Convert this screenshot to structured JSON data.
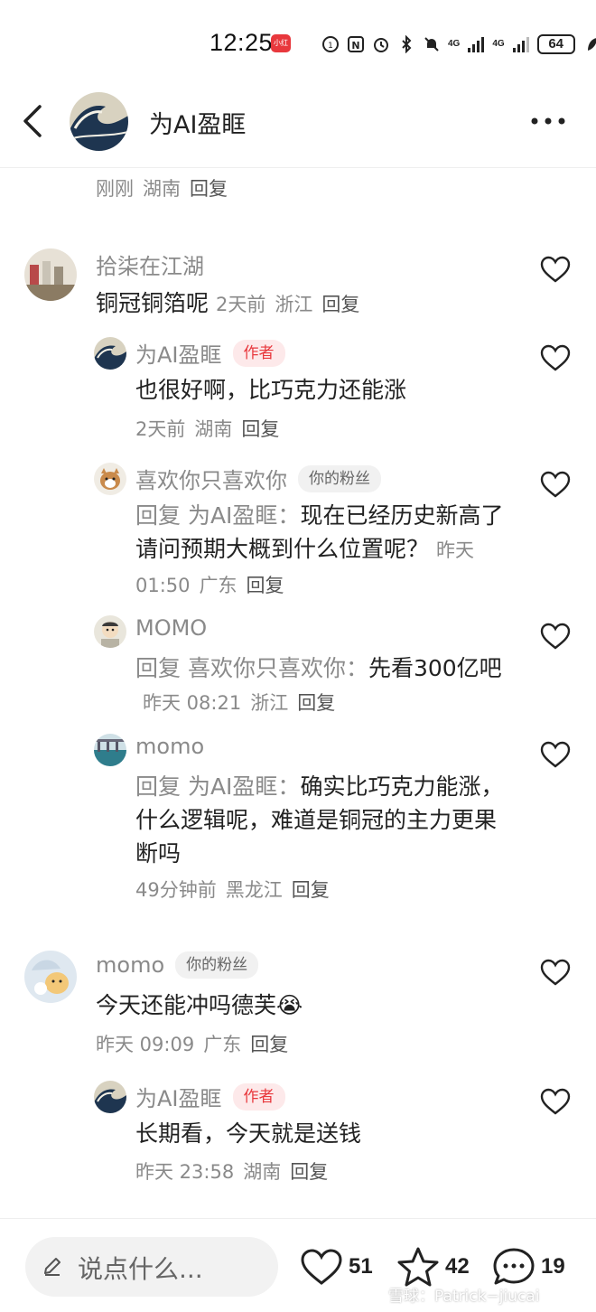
{
  "status_bar": {
    "time": "12:25",
    "badge": "小红书",
    "network_1": "4G",
    "network_2": "4G",
    "battery": "64"
  },
  "header": {
    "title": "为AI盈眶"
  },
  "top_meta": {
    "time": "刚刚",
    "location": "湖南",
    "reply": "回复"
  },
  "comments": [
    {
      "author": "拾柒在江湖",
      "text": "铜冠铜箔呢",
      "time": "2天前",
      "location": "浙江",
      "reply": "回复",
      "replies": [
        {
          "author": "为AI盈眶",
          "tag": "作者",
          "text": "也很好啊，比巧克力还能涨",
          "time": "2天前",
          "location": "湖南",
          "reply": "回复"
        },
        {
          "author": "喜欢你只喜欢你",
          "tag": "你的粉丝",
          "prefix": "回复 为AI盈眶：",
          "text": "现在已经历史新高了请问预期大概到什么位置呢？",
          "time": "昨天 01:50",
          "location": "广东",
          "reply": "回复"
        },
        {
          "author": "MOMO",
          "prefix": "回复 喜欢你只喜欢你：",
          "text": "先看300亿吧",
          "time": "昨天 08:21",
          "location": "浙江",
          "reply": "回复"
        },
        {
          "author": "momo",
          "prefix": "回复 为AI盈眶：",
          "text": "确实比巧克力能涨，什么逻辑呢，难道是铜冠的主力更果断吗",
          "time": "49分钟前",
          "location": "黑龙江",
          "reply": "回复"
        }
      ]
    },
    {
      "author": "momo",
      "tag": "你的粉丝",
      "text": "今天还能冲吗德芙",
      "emoji": "😭",
      "time": "昨天 09:09",
      "location": "广东",
      "reply": "回复",
      "replies": [
        {
          "author": "为AI盈眶",
          "tag": "作者",
          "text": "长期看，今天就是送钱",
          "time": "昨天 23:58",
          "location": "湖南",
          "reply": "回复"
        }
      ]
    }
  ],
  "bottom_bar": {
    "input_placeholder": "说点什么...",
    "likes": "51",
    "stars": "42",
    "comments": "19"
  },
  "watermark": "雪球：Patrick−jiucai",
  "colors": {
    "accent": "#e8383d",
    "author_tag_bg": "#fde9ea",
    "meta_gray": "#8a8a8a"
  },
  "icons": [
    "back-icon",
    "more-icon",
    "heart-icon",
    "star-icon",
    "comment-icon",
    "pen-icon"
  ]
}
